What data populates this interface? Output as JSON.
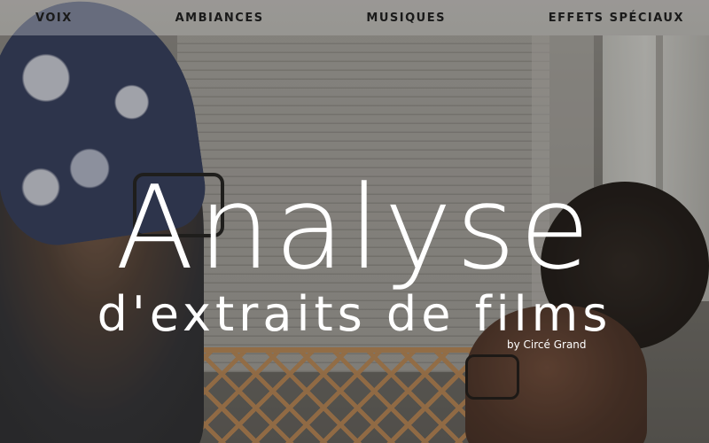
{
  "nav": {
    "items": [
      {
        "label": "VOIX"
      },
      {
        "label": "AMBIANCES"
      },
      {
        "label": "MUSIQUES"
      },
      {
        "label": "EFFETS SPÉCIAUX"
      }
    ]
  },
  "hero": {
    "title": "Analyse",
    "subtitle": "d'extraits de films",
    "byline": "by Circé Grand"
  },
  "colors": {
    "nav_background": "#ffffffb0",
    "nav_text": "#1a1a1a",
    "title_text": "#ffffff"
  }
}
